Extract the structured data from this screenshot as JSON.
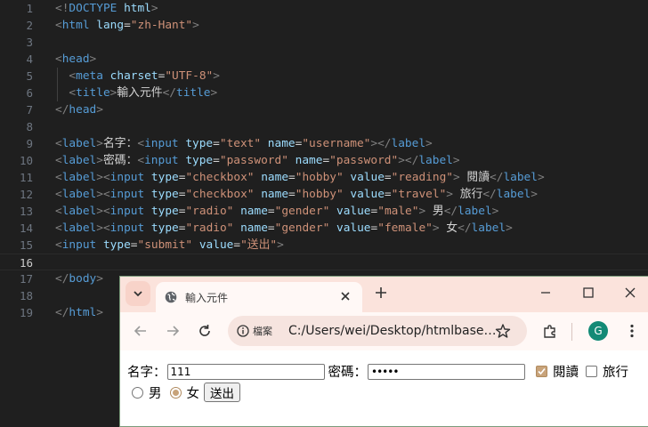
{
  "editor": {
    "line_numbers": [
      "1",
      "2",
      "3",
      "4",
      "5",
      "6",
      "7",
      "8",
      "9",
      "10",
      "11",
      "12",
      "13",
      "14",
      "15",
      "16",
      "17",
      "18",
      "19"
    ],
    "lines": [
      [
        {
          "t": "<!",
          "c": "t-br"
        },
        {
          "t": "DOCTYPE ",
          "c": "t-doc"
        },
        {
          "t": "html",
          "c": "t-attr"
        },
        {
          "t": ">",
          "c": "t-br"
        }
      ],
      [
        {
          "t": "<",
          "c": "t-br"
        },
        {
          "t": "html",
          "c": "t-tag"
        },
        {
          "t": " lang",
          "c": "t-attr"
        },
        {
          "t": "=",
          "c": "t-txt"
        },
        {
          "t": "\"zh-Hant\"",
          "c": "t-str"
        },
        {
          "t": ">",
          "c": "t-br"
        }
      ],
      [],
      [
        {
          "t": "<",
          "c": "t-br"
        },
        {
          "t": "head",
          "c": "t-tag"
        },
        {
          "t": ">",
          "c": "t-br"
        }
      ],
      [
        {
          "t": "  <",
          "c": "t-br"
        },
        {
          "t": "meta",
          "c": "t-tag"
        },
        {
          "t": " charset",
          "c": "t-attr"
        },
        {
          "t": "=",
          "c": "t-txt"
        },
        {
          "t": "\"UTF-8\"",
          "c": "t-str"
        },
        {
          "t": ">",
          "c": "t-br"
        }
      ],
      [
        {
          "t": "  <",
          "c": "t-br"
        },
        {
          "t": "title",
          "c": "t-tag"
        },
        {
          "t": ">",
          "c": "t-br"
        },
        {
          "t": "輸入元件",
          "c": "t-txt"
        },
        {
          "t": "</",
          "c": "t-br"
        },
        {
          "t": "title",
          "c": "t-tag"
        },
        {
          "t": ">",
          "c": "t-br"
        }
      ],
      [
        {
          "t": "</",
          "c": "t-br"
        },
        {
          "t": "head",
          "c": "t-tag"
        },
        {
          "t": ">",
          "c": "t-br"
        }
      ],
      [],
      [
        {
          "t": "<",
          "c": "t-br"
        },
        {
          "t": "label",
          "c": "t-tag"
        },
        {
          "t": ">",
          "c": "t-br"
        },
        {
          "t": "名字：",
          "c": "t-txt"
        },
        {
          "t": "<",
          "c": "t-br"
        },
        {
          "t": "input",
          "c": "t-tag"
        },
        {
          "t": " type",
          "c": "t-attr"
        },
        {
          "t": "=",
          "c": "t-txt"
        },
        {
          "t": "\"text\"",
          "c": "t-str"
        },
        {
          "t": " name",
          "c": "t-attr"
        },
        {
          "t": "=",
          "c": "t-txt"
        },
        {
          "t": "\"username\"",
          "c": "t-str"
        },
        {
          "t": "></",
          "c": "t-br"
        },
        {
          "t": "label",
          "c": "t-tag"
        },
        {
          "t": ">",
          "c": "t-br"
        }
      ],
      [
        {
          "t": "<",
          "c": "t-br"
        },
        {
          "t": "label",
          "c": "t-tag"
        },
        {
          "t": ">",
          "c": "t-br"
        },
        {
          "t": "密碼：",
          "c": "t-txt"
        },
        {
          "t": "<",
          "c": "t-br"
        },
        {
          "t": "input",
          "c": "t-tag"
        },
        {
          "t": " type",
          "c": "t-attr"
        },
        {
          "t": "=",
          "c": "t-txt"
        },
        {
          "t": "\"password\"",
          "c": "t-str"
        },
        {
          "t": " name",
          "c": "t-attr"
        },
        {
          "t": "=",
          "c": "t-txt"
        },
        {
          "t": "\"password\"",
          "c": "t-str"
        },
        {
          "t": "></",
          "c": "t-br"
        },
        {
          "t": "label",
          "c": "t-tag"
        },
        {
          "t": ">",
          "c": "t-br"
        }
      ],
      [
        {
          "t": "<",
          "c": "t-br"
        },
        {
          "t": "label",
          "c": "t-tag"
        },
        {
          "t": "><",
          "c": "t-br"
        },
        {
          "t": "input",
          "c": "t-tag"
        },
        {
          "t": " type",
          "c": "t-attr"
        },
        {
          "t": "=",
          "c": "t-txt"
        },
        {
          "t": "\"checkbox\"",
          "c": "t-str"
        },
        {
          "t": " name",
          "c": "t-attr"
        },
        {
          "t": "=",
          "c": "t-txt"
        },
        {
          "t": "\"hobby\"",
          "c": "t-str"
        },
        {
          "t": " value",
          "c": "t-attr"
        },
        {
          "t": "=",
          "c": "t-txt"
        },
        {
          "t": "\"reading\"",
          "c": "t-str"
        },
        {
          "t": ">",
          "c": "t-br"
        },
        {
          "t": " 閱讀",
          "c": "t-txt"
        },
        {
          "t": "</",
          "c": "t-br"
        },
        {
          "t": "label",
          "c": "t-tag"
        },
        {
          "t": ">",
          "c": "t-br"
        }
      ],
      [
        {
          "t": "<",
          "c": "t-br"
        },
        {
          "t": "label",
          "c": "t-tag"
        },
        {
          "t": "><",
          "c": "t-br"
        },
        {
          "t": "input",
          "c": "t-tag"
        },
        {
          "t": " type",
          "c": "t-attr"
        },
        {
          "t": "=",
          "c": "t-txt"
        },
        {
          "t": "\"checkbox\"",
          "c": "t-str"
        },
        {
          "t": " name",
          "c": "t-attr"
        },
        {
          "t": "=",
          "c": "t-txt"
        },
        {
          "t": "\"hobby\"",
          "c": "t-str"
        },
        {
          "t": " value",
          "c": "t-attr"
        },
        {
          "t": "=",
          "c": "t-txt"
        },
        {
          "t": "\"travel\"",
          "c": "t-str"
        },
        {
          "t": ">",
          "c": "t-br"
        },
        {
          "t": " 旅行",
          "c": "t-txt"
        },
        {
          "t": "</",
          "c": "t-br"
        },
        {
          "t": "label",
          "c": "t-tag"
        },
        {
          "t": ">",
          "c": "t-br"
        }
      ],
      [
        {
          "t": "<",
          "c": "t-br"
        },
        {
          "t": "label",
          "c": "t-tag"
        },
        {
          "t": "><",
          "c": "t-br"
        },
        {
          "t": "input",
          "c": "t-tag"
        },
        {
          "t": " type",
          "c": "t-attr"
        },
        {
          "t": "=",
          "c": "t-txt"
        },
        {
          "t": "\"radio\"",
          "c": "t-str"
        },
        {
          "t": " name",
          "c": "t-attr"
        },
        {
          "t": "=",
          "c": "t-txt"
        },
        {
          "t": "\"gender\"",
          "c": "t-str"
        },
        {
          "t": " value",
          "c": "t-attr"
        },
        {
          "t": "=",
          "c": "t-txt"
        },
        {
          "t": "\"male\"",
          "c": "t-str"
        },
        {
          "t": ">",
          "c": "t-br"
        },
        {
          "t": " 男",
          "c": "t-txt"
        },
        {
          "t": "</",
          "c": "t-br"
        },
        {
          "t": "label",
          "c": "t-tag"
        },
        {
          "t": ">",
          "c": "t-br"
        }
      ],
      [
        {
          "t": "<",
          "c": "t-br"
        },
        {
          "t": "label",
          "c": "t-tag"
        },
        {
          "t": "><",
          "c": "t-br"
        },
        {
          "t": "input",
          "c": "t-tag"
        },
        {
          "t": " type",
          "c": "t-attr"
        },
        {
          "t": "=",
          "c": "t-txt"
        },
        {
          "t": "\"radio\"",
          "c": "t-str"
        },
        {
          "t": " name",
          "c": "t-attr"
        },
        {
          "t": "=",
          "c": "t-txt"
        },
        {
          "t": "\"gender\"",
          "c": "t-str"
        },
        {
          "t": " value",
          "c": "t-attr"
        },
        {
          "t": "=",
          "c": "t-txt"
        },
        {
          "t": "\"female\"",
          "c": "t-str"
        },
        {
          "t": ">",
          "c": "t-br"
        },
        {
          "t": " 女",
          "c": "t-txt"
        },
        {
          "t": "</",
          "c": "t-br"
        },
        {
          "t": "label",
          "c": "t-tag"
        },
        {
          "t": ">",
          "c": "t-br"
        }
      ],
      [
        {
          "t": "<",
          "c": "t-br"
        },
        {
          "t": "input",
          "c": "t-tag"
        },
        {
          "t": " type",
          "c": "t-attr"
        },
        {
          "t": "=",
          "c": "t-txt"
        },
        {
          "t": "\"submit\"",
          "c": "t-str"
        },
        {
          "t": " value",
          "c": "t-attr"
        },
        {
          "t": "=",
          "c": "t-txt"
        },
        {
          "t": "\"送出\"",
          "c": "t-str"
        },
        {
          "t": ">",
          "c": "t-br"
        }
      ],
      [],
      [
        {
          "t": "</",
          "c": "t-br"
        },
        {
          "t": "body",
          "c": "t-tag"
        },
        {
          "t": ">",
          "c": "t-br"
        }
      ],
      [],
      [
        {
          "t": "</",
          "c": "t-br"
        },
        {
          "t": "html",
          "c": "t-tag"
        },
        {
          "t": ">",
          "c": "t-br"
        }
      ]
    ],
    "active_line": 16
  },
  "browser": {
    "tab": {
      "title": "輸入元件"
    },
    "site_info_label": "檔案",
    "url": "C:/Users/wei/Desktop/htmlbase…",
    "avatar_letter": "G",
    "form": {
      "name_label": "名字：",
      "name_value": "111",
      "password_label": "密碼：",
      "password_mask": "•••••",
      "hobby_reading_label": "閱讀",
      "hobby_reading_checked": true,
      "hobby_travel_label": "旅行",
      "hobby_travel_checked": false,
      "gender_male_label": "男",
      "gender_male_checked": false,
      "gender_female_label": "女",
      "gender_female_checked": true,
      "submit_label": "送出"
    }
  }
}
